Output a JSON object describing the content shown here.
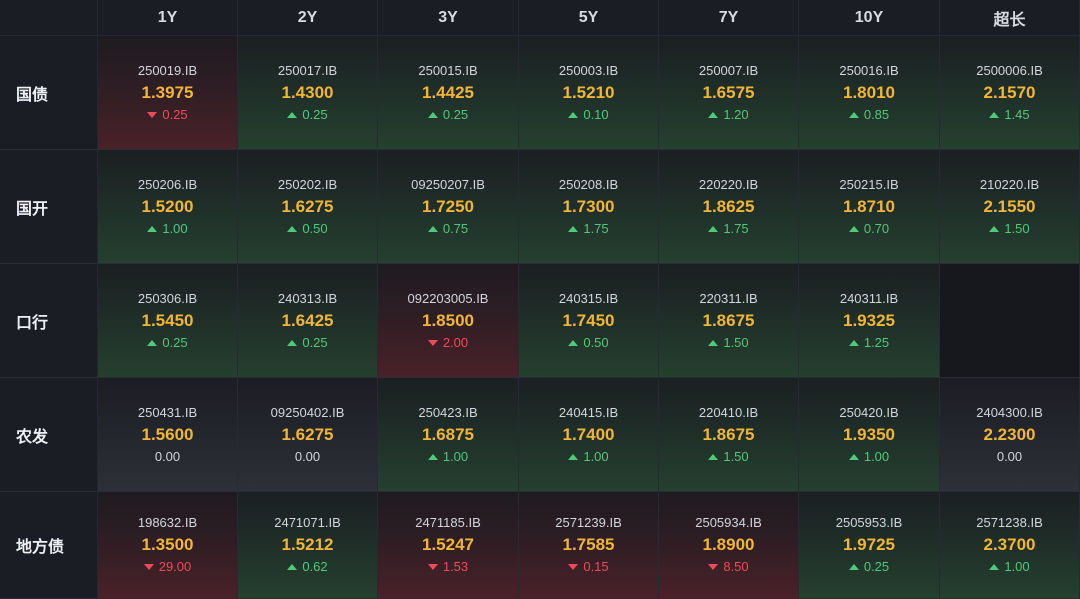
{
  "columns": [
    "1Y",
    "2Y",
    "3Y",
    "5Y",
    "7Y",
    "10Y",
    "超长"
  ],
  "rows": [
    {
      "label": "国债",
      "cells": [
        {
          "code": "250019.IB",
          "price": "1.3975",
          "change": "0.25",
          "dir": "down"
        },
        {
          "code": "250017.IB",
          "price": "1.4300",
          "change": "0.25",
          "dir": "up"
        },
        {
          "code": "250015.IB",
          "price": "1.4425",
          "change": "0.25",
          "dir": "up"
        },
        {
          "code": "250003.IB",
          "price": "1.5210",
          "change": "0.10",
          "dir": "up"
        },
        {
          "code": "250007.IB",
          "price": "1.6575",
          "change": "1.20",
          "dir": "up"
        },
        {
          "code": "250016.IB",
          "price": "1.8010",
          "change": "0.85",
          "dir": "up"
        },
        {
          "code": "2500006.IB",
          "price": "2.1570",
          "change": "1.45",
          "dir": "up"
        }
      ]
    },
    {
      "label": "国开",
      "cells": [
        {
          "code": "250206.IB",
          "price": "1.5200",
          "change": "1.00",
          "dir": "up"
        },
        {
          "code": "250202.IB",
          "price": "1.6275",
          "change": "0.50",
          "dir": "up"
        },
        {
          "code": "09250207.IB",
          "price": "1.7250",
          "change": "0.75",
          "dir": "up"
        },
        {
          "code": "250208.IB",
          "price": "1.7300",
          "change": "1.75",
          "dir": "up"
        },
        {
          "code": "220220.IB",
          "price": "1.8625",
          "change": "1.75",
          "dir": "up"
        },
        {
          "code": "250215.IB",
          "price": "1.8710",
          "change": "0.70",
          "dir": "up"
        },
        {
          "code": "210220.IB",
          "price": "2.1550",
          "change": "1.50",
          "dir": "up"
        }
      ]
    },
    {
      "label": "口行",
      "cells": [
        {
          "code": "250306.IB",
          "price": "1.5450",
          "change": "0.25",
          "dir": "up"
        },
        {
          "code": "240313.IB",
          "price": "1.6425",
          "change": "0.25",
          "dir": "up"
        },
        {
          "code": "092203005.IB",
          "price": "1.8500",
          "change": "2.00",
          "dir": "down"
        },
        {
          "code": "240315.IB",
          "price": "1.7450",
          "change": "0.50",
          "dir": "up"
        },
        {
          "code": "220311.IB",
          "price": "1.8675",
          "change": "1.50",
          "dir": "up"
        },
        {
          "code": "240311.IB",
          "price": "1.9325",
          "change": "1.25",
          "dir": "up"
        },
        {
          "code": "",
          "price": "",
          "change": "",
          "dir": "empty"
        }
      ]
    },
    {
      "label": "农发",
      "cells": [
        {
          "code": "250431.IB",
          "price": "1.5600",
          "change": "0.00",
          "dir": "flat"
        },
        {
          "code": "09250402.IB",
          "price": "1.6275",
          "change": "0.00",
          "dir": "flat"
        },
        {
          "code": "250423.IB",
          "price": "1.6875",
          "change": "1.00",
          "dir": "up"
        },
        {
          "code": "240415.IB",
          "price": "1.7400",
          "change": "1.00",
          "dir": "up"
        },
        {
          "code": "220410.IB",
          "price": "1.8675",
          "change": "1.50",
          "dir": "up"
        },
        {
          "code": "250420.IB",
          "price": "1.9350",
          "change": "1.00",
          "dir": "up"
        },
        {
          "code": "2404300.IB",
          "price": "2.2300",
          "change": "0.00",
          "dir": "flat"
        }
      ]
    },
    {
      "label": "地方债",
      "cells": [
        {
          "code": "198632.IB",
          "price": "1.3500",
          "change": "29.00",
          "dir": "down"
        },
        {
          "code": "2471071.IB",
          "price": "1.5212",
          "change": "0.62",
          "dir": "up"
        },
        {
          "code": "2471185.IB",
          "price": "1.5247",
          "change": "1.53",
          "dir": "down"
        },
        {
          "code": "2571239.IB",
          "price": "1.7585",
          "change": "0.15",
          "dir": "down"
        },
        {
          "code": "2505934.IB",
          "price": "1.8900",
          "change": "8.50",
          "dir": "down"
        },
        {
          "code": "2505953.IB",
          "price": "1.9725",
          "change": "0.25",
          "dir": "up"
        },
        {
          "code": "2571238.IB",
          "price": "2.3700",
          "change": "1.00",
          "dir": "up"
        }
      ]
    }
  ],
  "colors": {
    "price": "#f2b630",
    "up": "#4fc97a",
    "down": "#f04a5a",
    "flat": "#d3d6de"
  },
  "icons": {
    "up": "triangle-up-icon",
    "down": "triangle-down-icon"
  }
}
